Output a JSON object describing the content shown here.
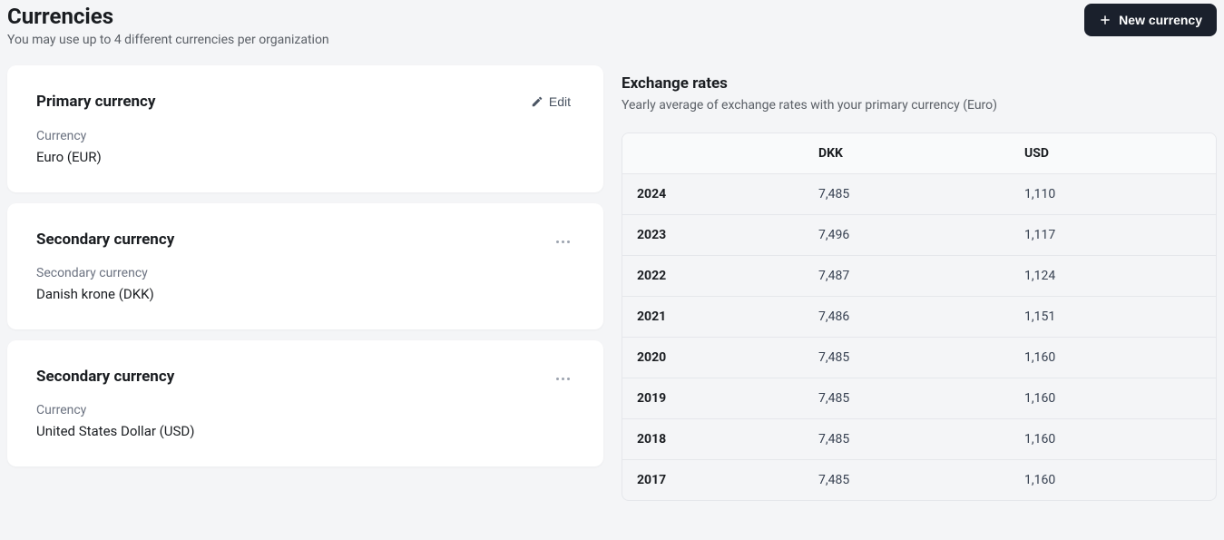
{
  "header": {
    "title": "Currencies",
    "subtitle": "You may use up to 4 different currencies per organization",
    "new_button": "New currency"
  },
  "primary_card": {
    "title": "Primary currency",
    "edit_label": "Edit",
    "field_label": "Currency",
    "field_value": "Euro (EUR)"
  },
  "secondary_cards": [
    {
      "title": "Secondary currency",
      "field_label": "Secondary currency",
      "field_value": "Danish krone (DKK)"
    },
    {
      "title": "Secondary currency",
      "field_label": "Currency",
      "field_value": "United States Dollar (USD)"
    }
  ],
  "rates": {
    "title": "Exchange rates",
    "subtitle": "Yearly average of exchange rates with your primary currency (Euro)",
    "columns": [
      "",
      "DKK",
      "USD"
    ],
    "rows": [
      {
        "year": "2024",
        "dkk": "7,485",
        "usd": "1,110"
      },
      {
        "year": "2023",
        "dkk": "7,496",
        "usd": "1,117"
      },
      {
        "year": "2022",
        "dkk": "7,487",
        "usd": "1,124"
      },
      {
        "year": "2021",
        "dkk": "7,486",
        "usd": "1,151"
      },
      {
        "year": "2020",
        "dkk": "7,485",
        "usd": "1,160"
      },
      {
        "year": "2019",
        "dkk": "7,485",
        "usd": "1,160"
      },
      {
        "year": "2018",
        "dkk": "7,485",
        "usd": "1,160"
      },
      {
        "year": "2017",
        "dkk": "7,485",
        "usd": "1,160"
      }
    ]
  }
}
